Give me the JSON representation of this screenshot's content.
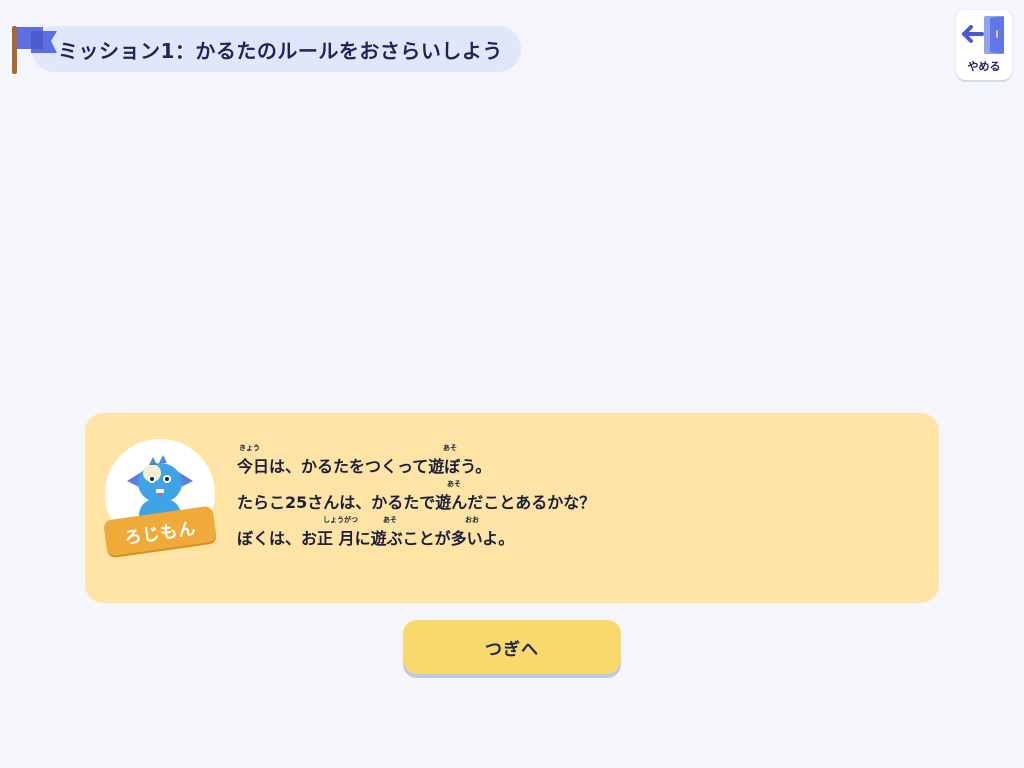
{
  "header": {
    "mission_title": "ミッション1：かるたのルールをおさらいしよう",
    "flag_icon": "flag-icon",
    "flag_color": "#5d6de2",
    "pole_color": "#a9692b"
  },
  "quit_button": {
    "label": "やめる",
    "icon": "exit-door-icon"
  },
  "dialog": {
    "character_name": "ろじもん",
    "lines": [
      {
        "text": "今日は、かるたをつくって遊ぼう。",
        "ruby": [
          {
            "base": "今日",
            "reading": "きょう"
          },
          {
            "base": "遊",
            "reading": "あそ"
          }
        ]
      },
      {
        "text": "たらこ25さんは、かるたで遊んだことあるかな？",
        "ruby": [
          {
            "base": "遊",
            "reading": "あそ"
          }
        ]
      },
      {
        "text": "ぼくは、お正 月に遊ぶことが多いよ。",
        "ruby": [
          {
            "base": "正月",
            "reading": "しょうがつ"
          },
          {
            "base": "遊",
            "reading": "あそ"
          },
          {
            "base": "多",
            "reading": "おお"
          }
        ]
      }
    ],
    "background_color": "#ffe4a6"
  },
  "next_button": {
    "label": "つぎへ",
    "color": "#f9d86c"
  }
}
